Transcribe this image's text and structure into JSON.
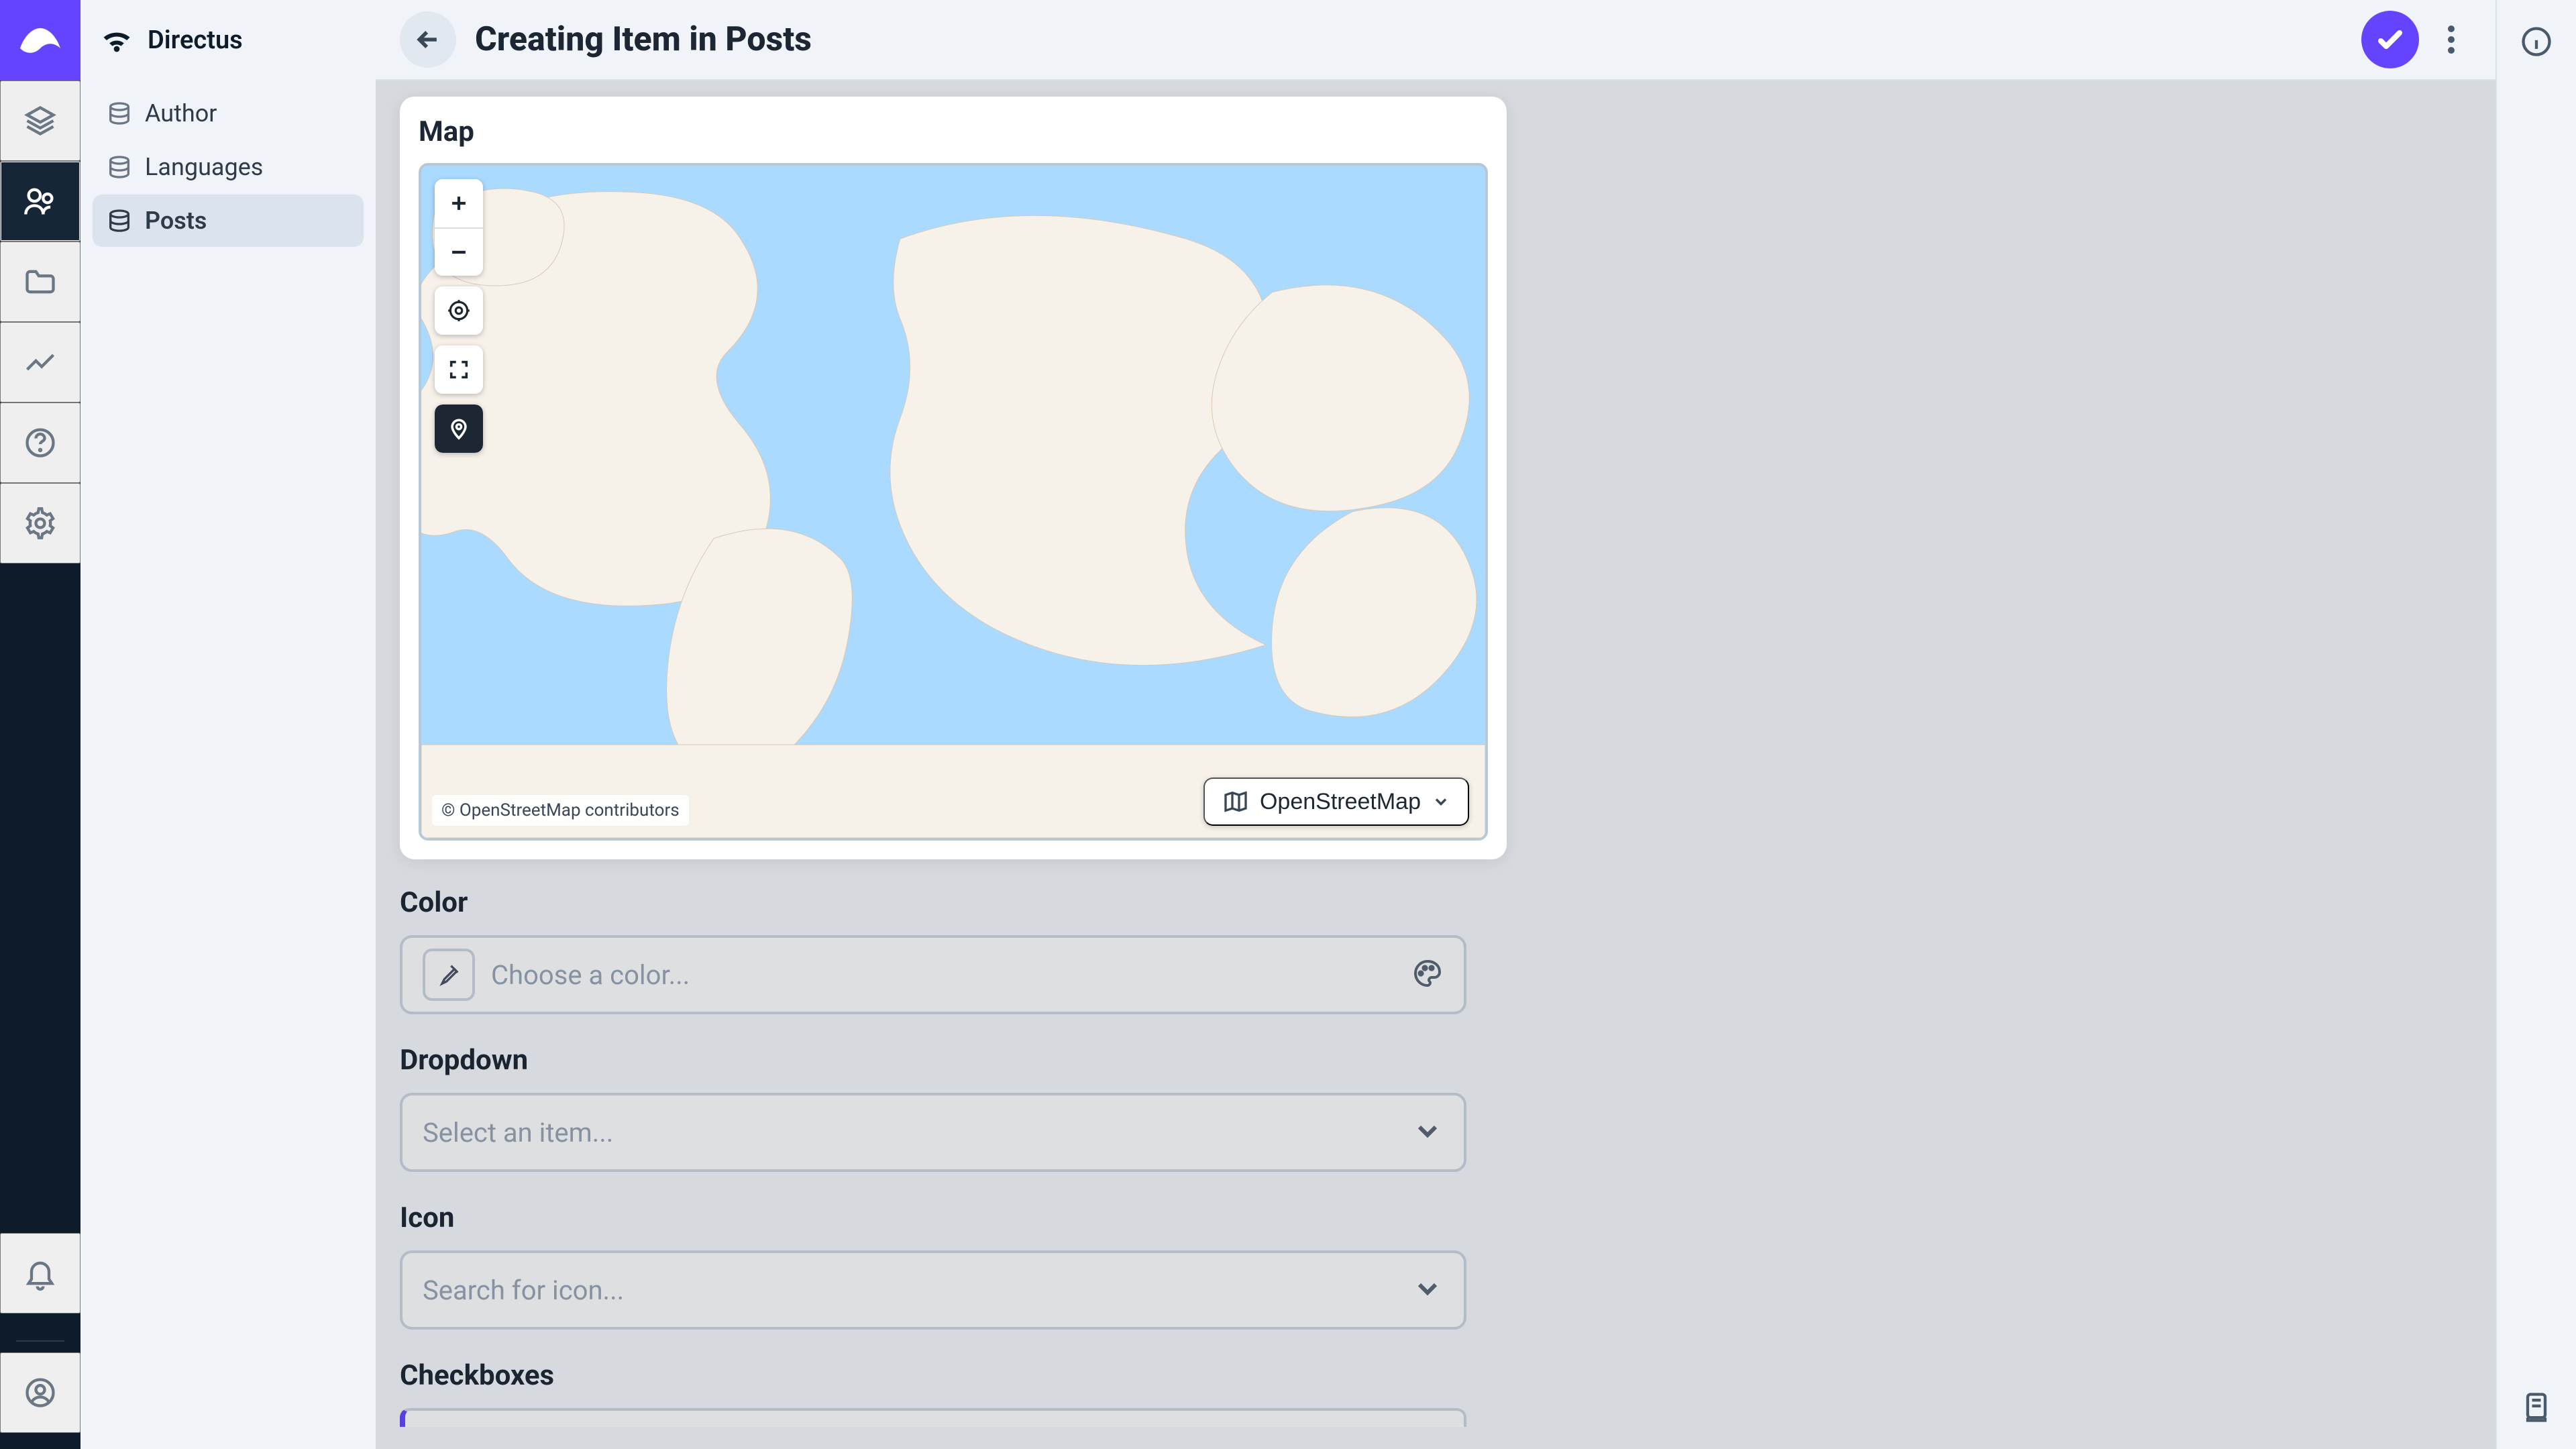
{
  "brand": {
    "name": "Directus"
  },
  "sidebar": {
    "items": [
      {
        "label": "Author"
      },
      {
        "label": "Languages"
      },
      {
        "label": "Posts"
      }
    ],
    "selected_index": 2
  },
  "header": {
    "title": "Creating Item in Posts"
  },
  "fields": {
    "map": {
      "label": "Map",
      "attribution": "© OpenStreetMap contributors",
      "basemap": "OpenStreetMap"
    },
    "color": {
      "label": "Color",
      "placeholder": "Choose a color..."
    },
    "dropdown": {
      "label": "Dropdown",
      "placeholder": "Select an item..."
    },
    "icon": {
      "label": "Icon",
      "placeholder": "Search for icon..."
    },
    "checkboxes": {
      "label": "Checkboxes"
    }
  },
  "colors": {
    "accent": "#6644ff",
    "rail_bg": "#0d1b2a",
    "water": "#aadaff",
    "land": "#f6f2ea"
  }
}
